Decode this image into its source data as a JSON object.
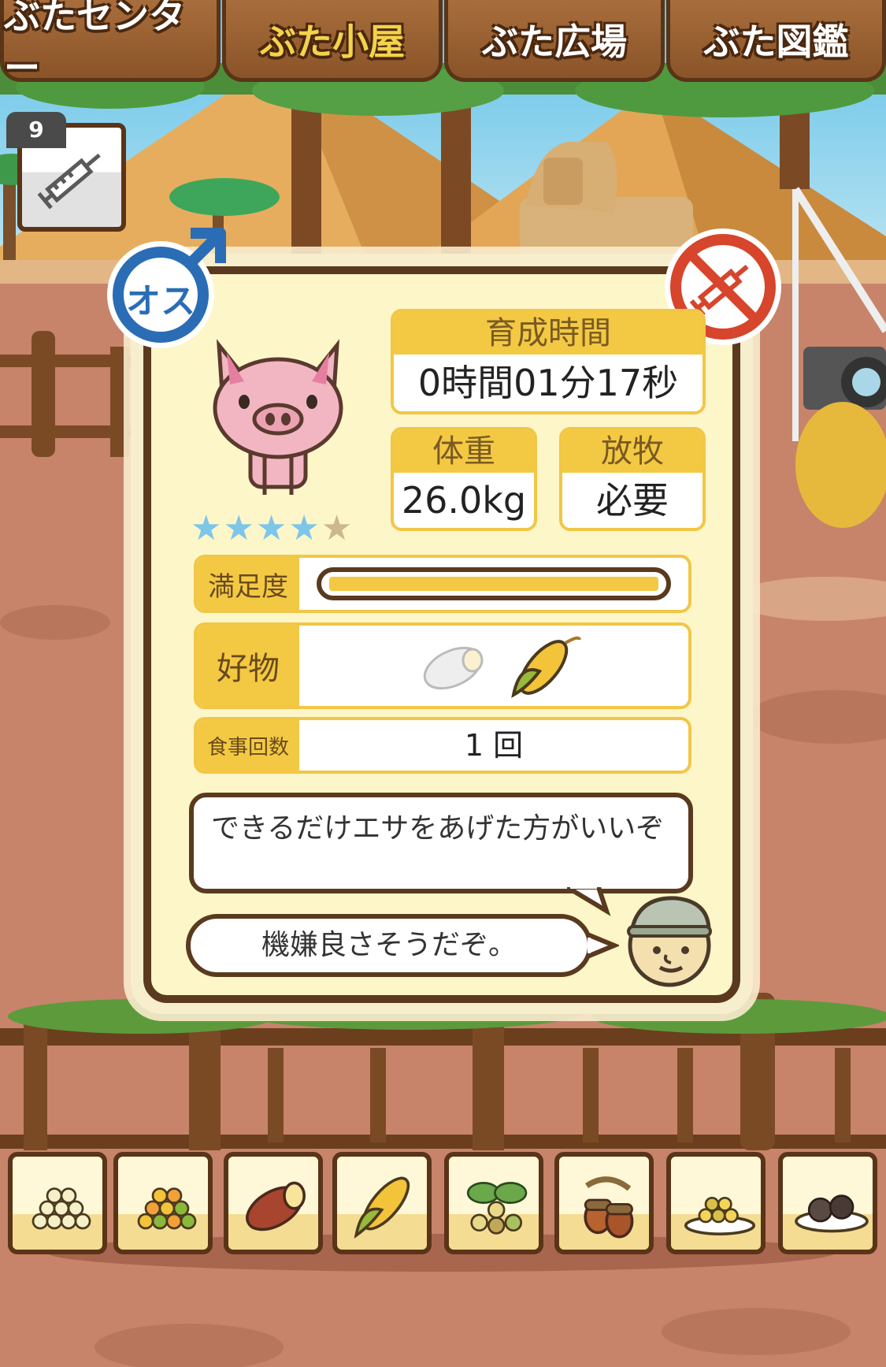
{
  "tabs": [
    {
      "label": "ぶたセンター",
      "active": false
    },
    {
      "label": "ぶた小屋",
      "active": true
    },
    {
      "label": "ぶた広場",
      "active": false
    },
    {
      "label": "ぶた図鑑",
      "active": false
    }
  ],
  "syringe_item": {
    "count": "9",
    "icon": "syringe-icon"
  },
  "pig_card": {
    "gender_label": "オス",
    "rating_stars": 4,
    "rating_max": 5,
    "growth_time": {
      "header": "育成時間",
      "value": "0時間01分17秒"
    },
    "weight": {
      "header": "体重",
      "value": "26.0kg"
    },
    "grazing": {
      "header": "放牧",
      "value": "必要"
    },
    "satisfaction": {
      "label": "満足度",
      "level": 1.0
    },
    "favorites": {
      "label": "好物",
      "items": [
        "sweet-potato-icon",
        "corn-icon"
      ]
    },
    "meal_count": {
      "label": "食事回数",
      "value": "1 回"
    },
    "advice": "できるだけエサをあげた方がいいぞ",
    "mood": "機嫌良さそうだぞ。"
  },
  "food_bar": [
    "grain-pile-icon",
    "mixed-grain-icon",
    "sweet-potato-icon",
    "corn-icon",
    "beans-leaves-icon",
    "acorn-icon",
    "grain-plate-icon",
    "truffle-plate-icon"
  ],
  "colors": {
    "accent": "#f3c943",
    "frame": "#5a3a1e",
    "card": "#fdf6c9",
    "gender_blue": "#2a6db5",
    "no_syringe_red": "#d6452c"
  }
}
